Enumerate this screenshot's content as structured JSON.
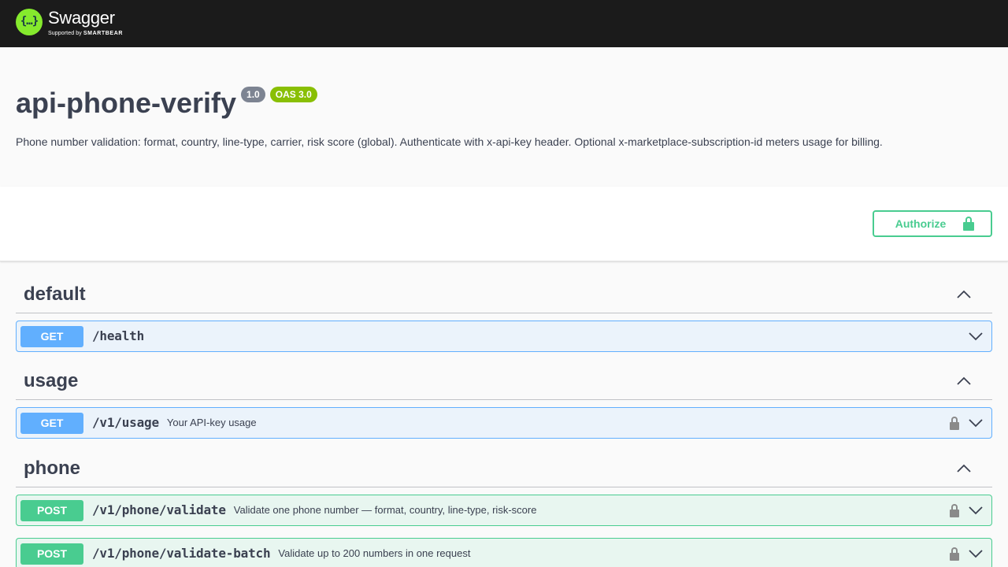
{
  "header": {
    "logo_text": "Swagger",
    "logo_symbol": "{…}",
    "supported_by": "Supported by",
    "smartbear": "SMARTBEAR"
  },
  "info": {
    "title": "api-phone-verify",
    "version": "1.0",
    "oas": "OAS 3.0",
    "description": "Phone number validation: format, country, line-type, carrier, risk score (global). Authenticate with x-api-key header. Optional x-marketplace-subscription-id meters usage for billing."
  },
  "authorize": {
    "label": "Authorize"
  },
  "tags": [
    {
      "name": "default",
      "operations": [
        {
          "method": "GET",
          "path": "/health",
          "summary": "",
          "locked": false
        }
      ]
    },
    {
      "name": "usage",
      "operations": [
        {
          "method": "GET",
          "path": "/v1/usage",
          "summary": "Your API-key usage",
          "locked": true
        }
      ]
    },
    {
      "name": "phone",
      "operations": [
        {
          "method": "POST",
          "path": "/v1/phone/validate",
          "summary": "Validate one phone number — format, country, line-type, risk-score",
          "locked": true
        },
        {
          "method": "POST",
          "path": "/v1/phone/validate-batch",
          "summary": "Validate up to 200 numbers in one request",
          "locked": true
        }
      ]
    }
  ],
  "colors": {
    "get": "#61affe",
    "post": "#49cc90",
    "topbar": "#1b1b1b",
    "logo": "#85ea2d"
  },
  "icons": [
    "swagger-logo-icon",
    "lock-icon",
    "chevron-up-icon",
    "chevron-down-icon"
  ]
}
